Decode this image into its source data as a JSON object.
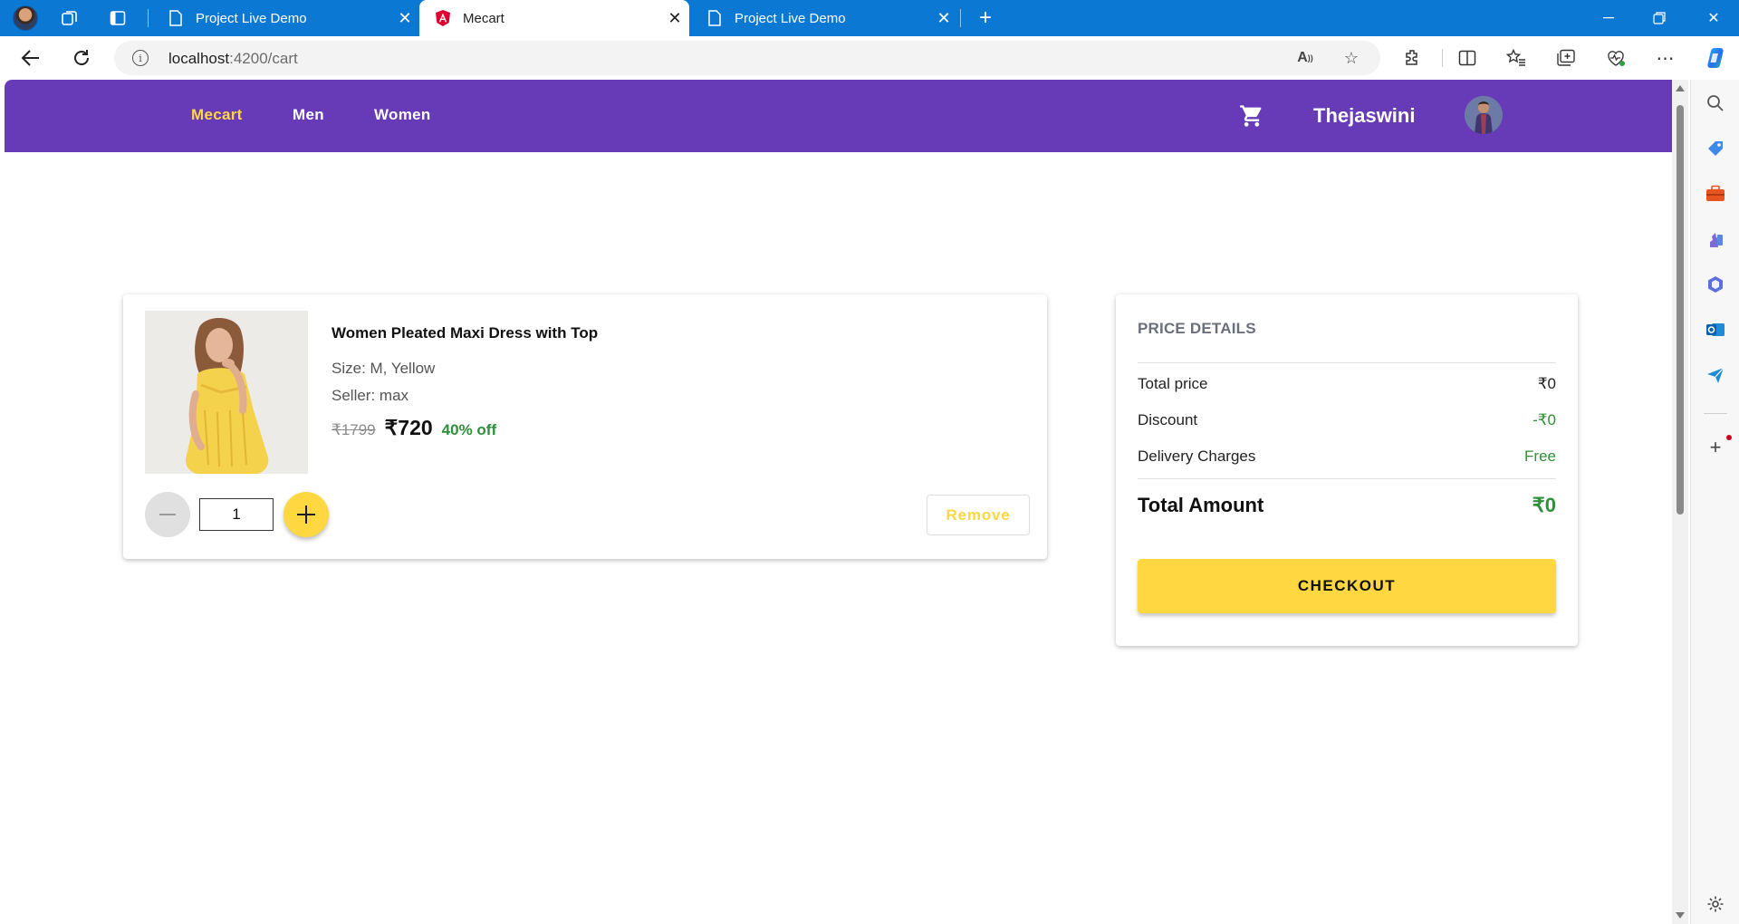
{
  "browser": {
    "tabs": [
      {
        "title": "Project Live Demo",
        "active": false
      },
      {
        "title": "Mecart",
        "active": true
      },
      {
        "title": "Project Live Demo",
        "active": false
      }
    ],
    "url_host": "localhost",
    "url_rest": ":4200/cart",
    "theme_color": "#0b78d4"
  },
  "nav": {
    "brand": "Mecart",
    "links": [
      "Men",
      "Women"
    ],
    "user_name": "Thejaswini",
    "bar_color": "#673ab7",
    "accent_color": "#ffd740"
  },
  "cart_item": {
    "title": "Women Pleated Maxi Dress with Top",
    "size": "Size: M, Yellow",
    "seller": "Seller: max",
    "original_price": "₹1799",
    "price": "₹720",
    "discount": "40% off",
    "quantity": "1",
    "remove_label": "Remove"
  },
  "price_details": {
    "title": "PRICE DETAILS",
    "rows": [
      {
        "label": "Total price",
        "value": "₹0"
      },
      {
        "label": "Discount",
        "value": "-₹0"
      },
      {
        "label": "Delivery Charges",
        "value": "Free"
      }
    ],
    "total_label": "Total Amount",
    "total_value": "₹0",
    "checkout_label": "CHECKOUT"
  },
  "icons": {
    "cart": "shopping-cart-icon",
    "avatar": "user-avatar"
  }
}
